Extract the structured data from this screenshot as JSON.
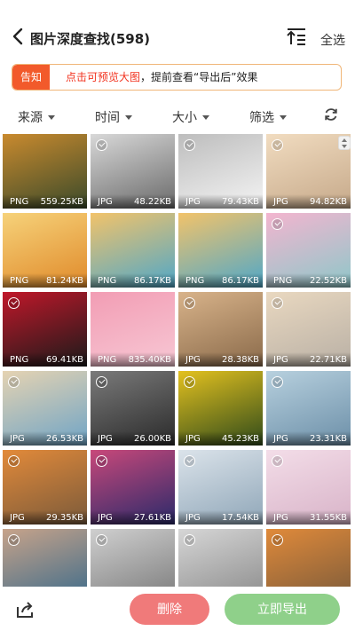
{
  "header": {
    "title": "图片深度查找(598)",
    "select_all": "全选"
  },
  "notice": {
    "tag": "告知",
    "highlight": "点击可预览大图",
    "rest": "，提前查看“导出后”效果"
  },
  "filters": [
    {
      "label": "来源"
    },
    {
      "label": "时间"
    },
    {
      "label": "大小"
    },
    {
      "label": "筛选"
    }
  ],
  "images": [
    {
      "format": "PNG",
      "size": "559.25KB",
      "selected": false,
      "icon": "cartoon-poster-thumbnail"
    },
    {
      "format": "JPG",
      "size": "48.22KB",
      "selected": true,
      "icon": "sketch-portrait-thumbnail"
    },
    {
      "format": "JPG",
      "size": "79.43KB",
      "selected": true,
      "icon": "line-art-thumbnail"
    },
    {
      "format": "JPG",
      "size": "94.82KB",
      "selected": true,
      "icon": "anime-girl-thumbnail"
    },
    {
      "format": "PNG",
      "size": "81.24KB",
      "selected": false,
      "icon": "cartoon-pirate-thumbnail"
    },
    {
      "format": "PNG",
      "size": "86.17KB",
      "selected": false,
      "icon": "cartoon-boy-trophy-thumbnail"
    },
    {
      "format": "PNG",
      "size": "86.17KB",
      "selected": false,
      "icon": "cartoon-boy-trophy-thumbnail"
    },
    {
      "format": "PNG",
      "size": "22.52KB",
      "selected": true,
      "icon": "anime-pink-hair-thumbnail"
    },
    {
      "format": "PNG",
      "size": "69.41KB",
      "selected": true,
      "icon": "dark-helmet-thumbnail"
    },
    {
      "format": "PNG",
      "size": "835.40KB",
      "selected": false,
      "icon": "birthday-card-thumbnail"
    },
    {
      "format": "JPG",
      "size": "28.38KB",
      "selected": true,
      "icon": "dancer-street-thumbnail"
    },
    {
      "format": "JPG",
      "size": "22.71KB",
      "selected": true,
      "icon": "blonde-woman-thumbnail"
    },
    {
      "format": "JPG",
      "size": "26.53KB",
      "selected": true,
      "icon": "beach-surfer-thumbnail"
    },
    {
      "format": "JPG",
      "size": "26.00KB",
      "selected": true,
      "icon": "gray-cat-thumbnail"
    },
    {
      "format": "JPG",
      "size": "45.23KB",
      "selected": true,
      "icon": "yellow-otter-thumbnail"
    },
    {
      "format": "JPG",
      "size": "23.31KB",
      "selected": true,
      "icon": "surfer-wave-thumbnail"
    },
    {
      "format": "JPG",
      "size": "29.35KB",
      "selected": true,
      "icon": "dancer-orange-thumbnail"
    },
    {
      "format": "JPG",
      "size": "27.61KB",
      "selected": true,
      "icon": "couple-neon-thumbnail"
    },
    {
      "format": "JPG",
      "size": "17.54KB",
      "selected": true,
      "icon": "woman-dancing-thumbnail"
    },
    {
      "format": "JPG",
      "size": "31.55KB",
      "selected": true,
      "icon": "anime-portrait-thumbnail"
    },
    {
      "format": "",
      "size": "",
      "selected": true,
      "icon": "man-cap-thumbnail"
    },
    {
      "format": "",
      "size": "",
      "selected": true,
      "icon": "people-street-thumbnail"
    },
    {
      "format": "",
      "size": "",
      "selected": true,
      "icon": "cat-thumbnail"
    },
    {
      "format": "",
      "size": "",
      "selected": true,
      "icon": "dancer-orange-2-thumbnail"
    }
  ],
  "actions": {
    "delete": "删除",
    "export": "立即导出"
  }
}
